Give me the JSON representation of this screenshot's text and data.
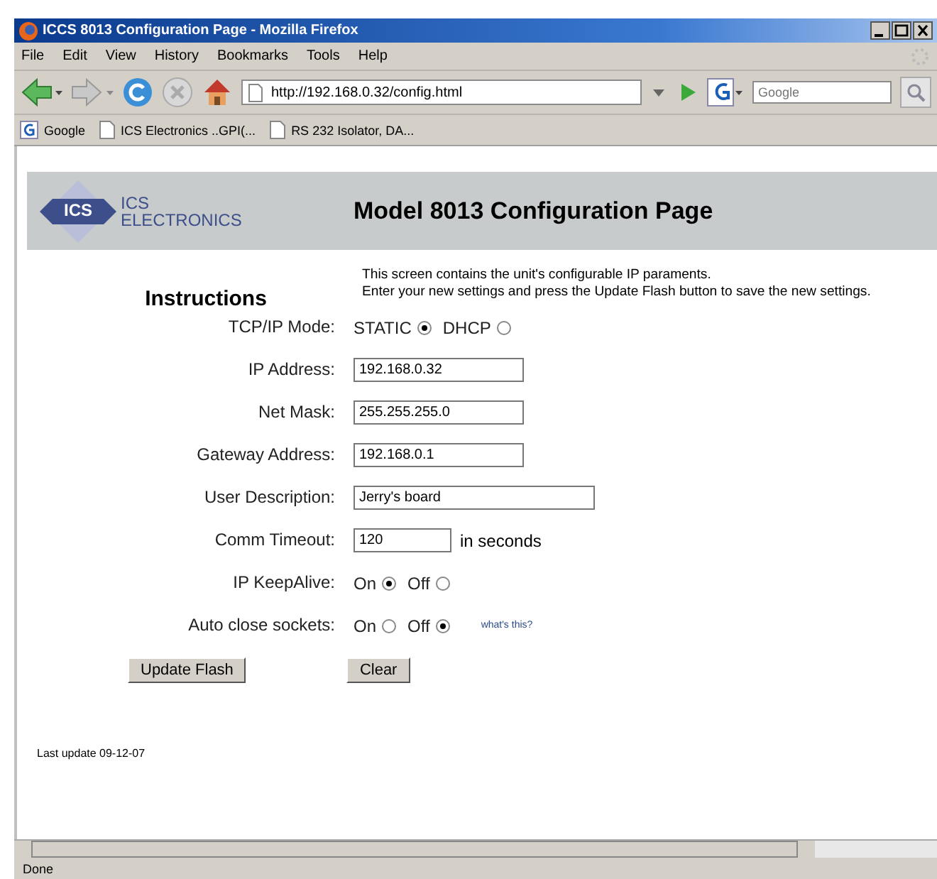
{
  "window": {
    "title": "ICCS 8013 Configuration Page - Mozilla Firefox"
  },
  "menu": [
    "File",
    "Edit",
    "View",
    "History",
    "Bookmarks",
    "Tools",
    "Help"
  ],
  "toolbar": {
    "url": "http://192.168.0.32/config.html",
    "search_placeholder": "Google"
  },
  "bookmarks": [
    {
      "label": "Google",
      "kind": "google"
    },
    {
      "label": "ICS Electronics ..GPI(...",
      "kind": "page"
    },
    {
      "label": "RS 232 Isolator, DA...",
      "kind": "page"
    }
  ],
  "page": {
    "logo": {
      "mark": "ICS",
      "line_1": "ICS",
      "line_2": "ELECTRONICS"
    },
    "heading": "Model 8013 Configuration Page",
    "instructions_title": "Instructions",
    "intro": [
      "This screen contains the unit's configurable IP paraments.",
      "Enter your new settings and press the Update Flash button to save the new settings."
    ],
    "fields": [
      {
        "kind": "radio",
        "label": "TCP/IP Mode:",
        "options": [
          {
            "label": "STATIC",
            "selected": true
          },
          {
            "label": "DHCP",
            "selected": false
          }
        ]
      },
      {
        "kind": "text",
        "label": "IP Address:",
        "value": "192.168.0.32"
      },
      {
        "kind": "text",
        "label": "Net Mask:",
        "value": "255.255.255.0"
      },
      {
        "kind": "text",
        "label": "Gateway Address:",
        "value": "192.168.0.1"
      },
      {
        "kind": "text",
        "label": "User Description:",
        "value": "Jerry's board"
      },
      {
        "kind": "text",
        "label": "Comm Timeout:",
        "value": "120",
        "suffix": "in seconds"
      },
      {
        "kind": "radio",
        "label": "IP KeepAlive:",
        "options": [
          {
            "label": "On",
            "selected": true
          },
          {
            "label": "Off",
            "selected": false
          }
        ]
      },
      {
        "kind": "radio",
        "label": "Auto close sockets:",
        "options": [
          {
            "label": "On",
            "selected": false
          },
          {
            "label": "Off",
            "selected": true
          }
        ],
        "link": "what's this?"
      }
    ],
    "buttons": [
      "Update Flash",
      "Clear"
    ],
    "footer": "Last update 09-12-07"
  },
  "status_bar": "Done"
}
